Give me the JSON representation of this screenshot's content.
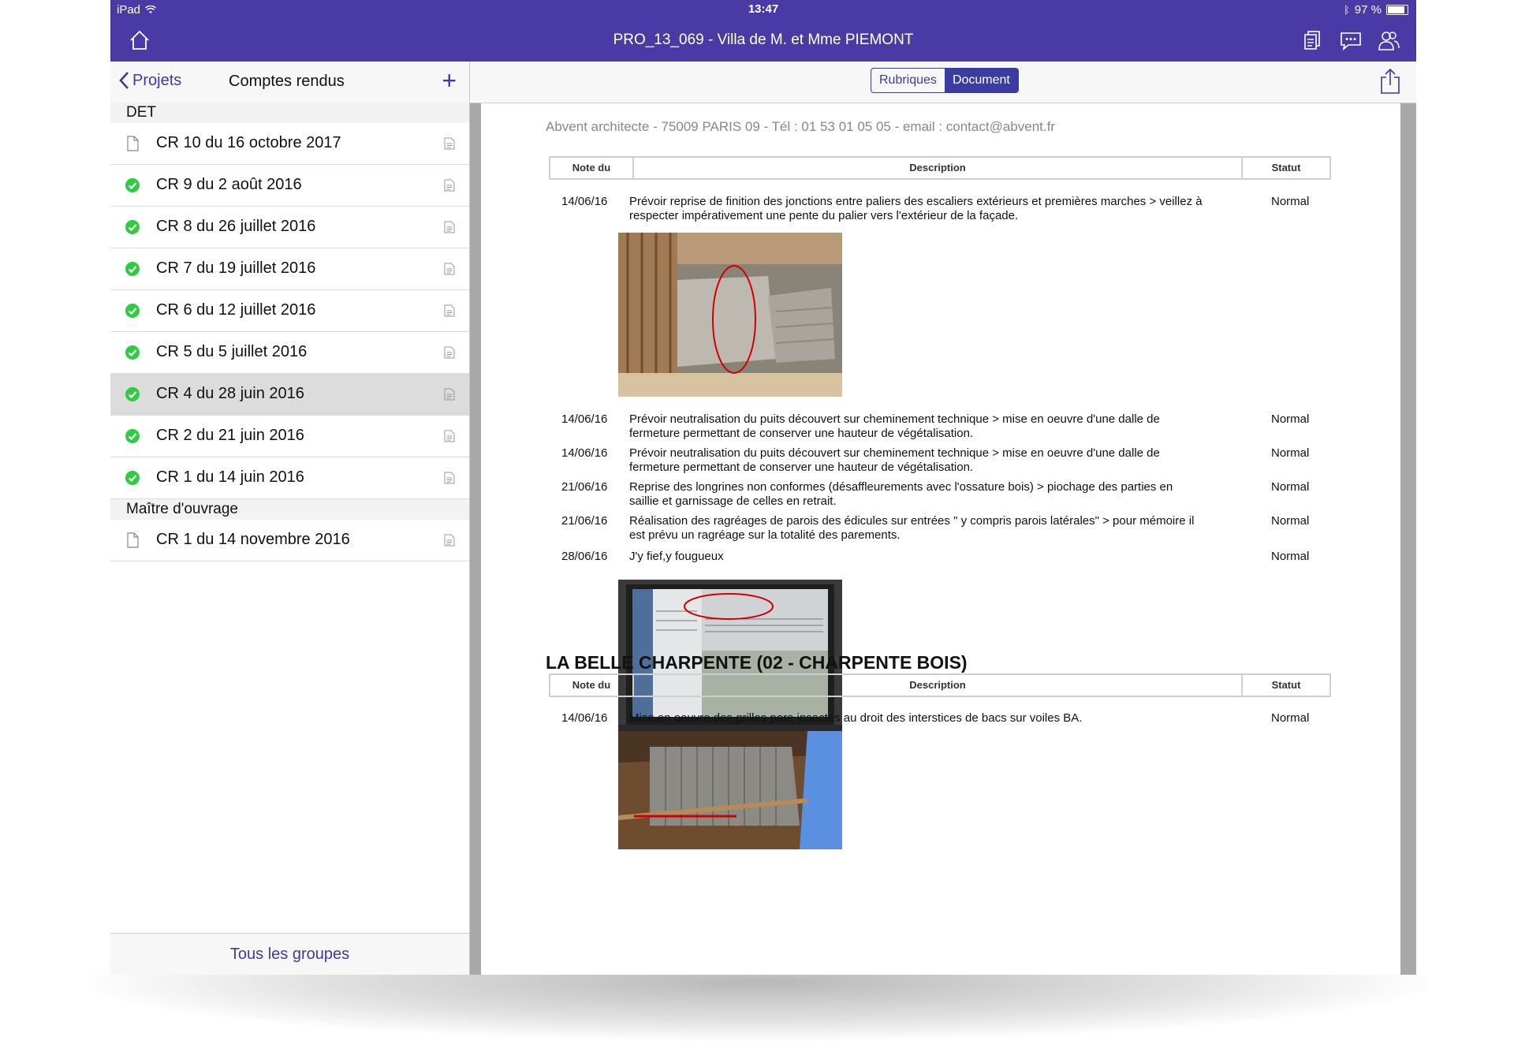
{
  "status_bar": {
    "device": "iPad",
    "time": "13:47",
    "battery": "97 %",
    "battery_level": 0.97
  },
  "nav": {
    "title": "PRO_13_069 - Villa de M. et Mme PIEMONT"
  },
  "left_pane": {
    "back_label": "Projets",
    "title": "Comptes rendus",
    "add_label": "+",
    "groups": [
      {
        "name": "DET",
        "items": [
          {
            "label": "CR 10 du 16 octobre 2017",
            "status": "draft"
          },
          {
            "label": "CR 9 du 2 août 2016",
            "status": "sent"
          },
          {
            "label": "CR 8 du 26 juillet 2016",
            "status": "sent"
          },
          {
            "label": "CR 7 du 19 juillet 2016",
            "status": "sent"
          },
          {
            "label": "CR 6 du 12 juillet 2016",
            "status": "sent"
          },
          {
            "label": "CR 5 du 5 juillet 2016",
            "status": "sent"
          },
          {
            "label": "CR 4 du 28 juin 2016",
            "status": "sent",
            "selected": true
          },
          {
            "label": "CR 2 du 21 juin 2016",
            "status": "sent"
          },
          {
            "label": "CR 1 du 14 juin 2016",
            "status": "sent"
          }
        ]
      },
      {
        "name": "Maître d'ouvrage",
        "items": [
          {
            "label": "CR 1 du 14 novembre 2016",
            "status": "draft"
          }
        ]
      }
    ],
    "footer": "Tous les groupes"
  },
  "right_pane": {
    "segments": [
      "Rubriques",
      "Document"
    ],
    "active_segment": "Document"
  },
  "document": {
    "header": "Abvent architecte  - 75009 PARIS 09 - Tél : 01 53 01 05 05 - email : contact@abvent.fr",
    "columns": {
      "date": "Note du",
      "description": "Description",
      "status": "Statut"
    },
    "entries": [
      {
        "date": "14/06/16",
        "text": "Prévoir reprise de finition des jonctions entre paliers des escaliers extérieurs et premières marches > veillez à respecter impérativement une pente du palier vers l'extérieur de la façade.",
        "status": "Normal"
      },
      {
        "date": "14/06/16",
        "text": "Prévoir neutralisation du puits découvert sur cheminement technique > mise en oeuvre d'une dalle de fermeture permettant de conserver une hauteur de végétalisation.",
        "status": "Normal"
      },
      {
        "date": "14/06/16",
        "text": "Prévoir neutralisation du puits découvert sur cheminement technique > mise en oeuvre d'une dalle de fermeture permettant de conserver une hauteur de végétalisation.",
        "status": "Normal"
      },
      {
        "date": "21/06/16",
        "text": "Reprise des longrines non conformes (désaffleurements avec l'ossature bois) > piochage des parties en saillie et garnissage de celles en retrait.",
        "status": "Normal"
      },
      {
        "date": "21/06/16",
        "text": "Réalisation des ragréages de parois des édicules sur entrées \" y compris parois latérales\" > pour mémoire il est prévu un ragréage sur la totalité des parements.",
        "status": "Normal"
      },
      {
        "date": "28/06/16",
        "text": "J'y fief,y fougueux",
        "status": "Normal"
      }
    ],
    "section2_title": "LA BELLE CHARPENTE (02 - CHARPENTE BOIS)",
    "section2_entries": [
      {
        "date": "14/06/16",
        "text": "Mise en oeuvre des grilles pare insectes au droit des interstices de bacs sur voiles BA.",
        "status": "Normal"
      }
    ]
  },
  "colors": {
    "accent": "#4a3aa6",
    "link": "#3b3ba0",
    "check": "#2ecc40",
    "annotation": "#d00000"
  }
}
